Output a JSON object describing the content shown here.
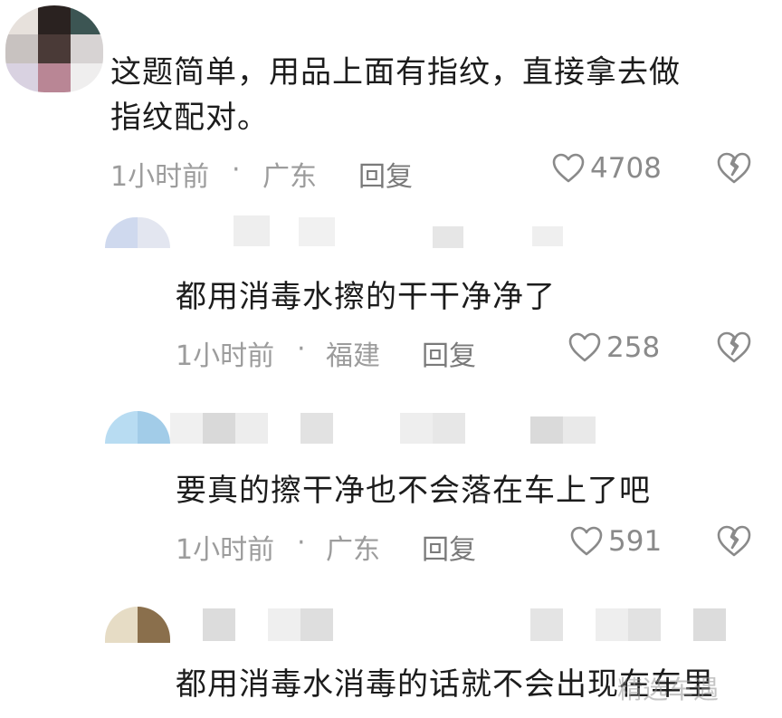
{
  "comments": [
    {
      "text_line1": "这题简单，用品上面有指纹，直接拿去做",
      "text_line2": "指纹配对。",
      "time": "1小时前",
      "separator": "·",
      "location": "广东",
      "reply_label": "回复",
      "likes": "4708"
    },
    {
      "text": "都用消毒水擦的干干净净了",
      "time": "1小时前",
      "separator": "·",
      "location": "福建",
      "reply_label": "回复",
      "likes": "258"
    },
    {
      "text": "要真的擦干净也不会落在车上了吧",
      "time": "1小时前",
      "separator": "·",
      "location": "广东",
      "reply_label": "回复",
      "likes": "591"
    },
    {
      "text": "都用消毒水消毒的话就不会出现在车里"
    }
  ],
  "watermark": "精选车遇",
  "icons": {
    "like": "heart-outline-icon",
    "dislike": "broken-heart-icon"
  },
  "colors": {
    "text": "#1c1c1c",
    "meta": "#9c9c9c",
    "icon": "#8a8a8a"
  }
}
